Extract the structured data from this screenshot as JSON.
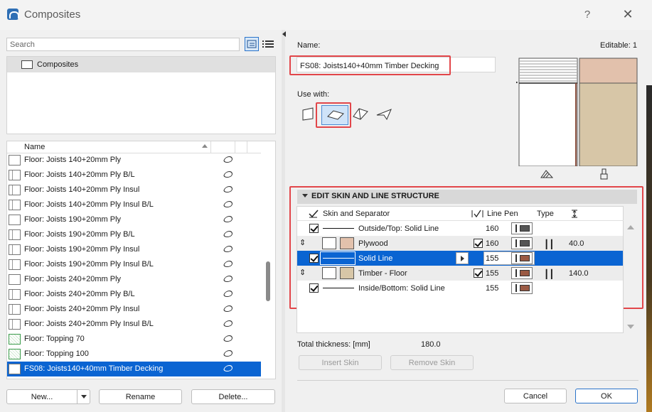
{
  "window": {
    "title": "Composites",
    "help_label": "?",
    "close_label": "✕"
  },
  "left": {
    "search_placeholder": "Search",
    "tree_root": "Composites",
    "list_header": "Name",
    "items": [
      "Floor: Joists 140+20mm Ply",
      "Floor: Joists 140+20mm Ply B/L",
      "Floor: Joists 140+20mm Ply Insul",
      "Floor: Joists 140+20mm Ply Insul B/L",
      "Floor: Joists 190+20mm Ply",
      "Floor: Joists 190+20mm Ply B/L",
      "Floor: Joists 190+20mm Ply Insul",
      "Floor: Joists 190+20mm Ply Insul B/L",
      "Floor: Joists 240+20mm Ply",
      "Floor: Joists 240+20mm Ply B/L",
      "Floor: Joists 240+20mm Ply Insul",
      "Floor: Joists 240+20mm Ply Insul B/L",
      "Floor: Topping 70",
      "Floor: Topping 100",
      "FS08: Joists140+40mm Timber Decking"
    ],
    "selected_index": 14,
    "buttons": {
      "new": "New...",
      "rename": "Rename",
      "delete": "Delete..."
    }
  },
  "right": {
    "name_label": "Name:",
    "editable_label": "Editable: 1",
    "name_value": "FS08: Joists140+40mm Timber Decking",
    "use_with_label": "Use with:",
    "use_with_icons": [
      "wall-icon",
      "slab-icon",
      "roof-icon",
      "shell-icon"
    ],
    "use_with_selected": "slab-icon",
    "section_title": "EDIT SKIN AND LINE STRUCTURE",
    "grid_headers": {
      "skin": "Skin and Separator",
      "line": "Line",
      "pen": "Pen",
      "type": "Type"
    },
    "rows": [
      {
        "kind": "line",
        "checked": true,
        "label": "Outside/Top: Solid Line",
        "pen": "160",
        "pen_color": "#555555"
      },
      {
        "kind": "skin",
        "label": "Plywood",
        "line_checked": true,
        "pen": "160",
        "pen_color": "#555555",
        "thickness": "40.0",
        "fill": "#e2c1ac"
      },
      {
        "kind": "line",
        "checked": true,
        "label": "Solid Line",
        "pen": "155",
        "pen_color": "#9a5a44",
        "selected": true
      },
      {
        "kind": "skin",
        "label": "Timber - Floor",
        "line_checked": true,
        "pen": "155",
        "pen_color": "#9a5a44",
        "thickness": "140.0",
        "fill": "#d7c6a7"
      },
      {
        "kind": "line",
        "checked": true,
        "label": "Inside/Bottom: Solid Line",
        "pen": "155",
        "pen_color": "#9a5a44"
      }
    ],
    "total_label": "Total thickness: [mm]",
    "total_value": "180.0",
    "insert_skin": "Insert Skin",
    "remove_skin": "Remove Skin",
    "cancel": "Cancel",
    "ok": "OK"
  },
  "colors": {
    "accent": "#0a64d2",
    "highlight": "#e2464a",
    "plywood": "#e2c1ac",
    "timber": "#d7c6a7"
  }
}
